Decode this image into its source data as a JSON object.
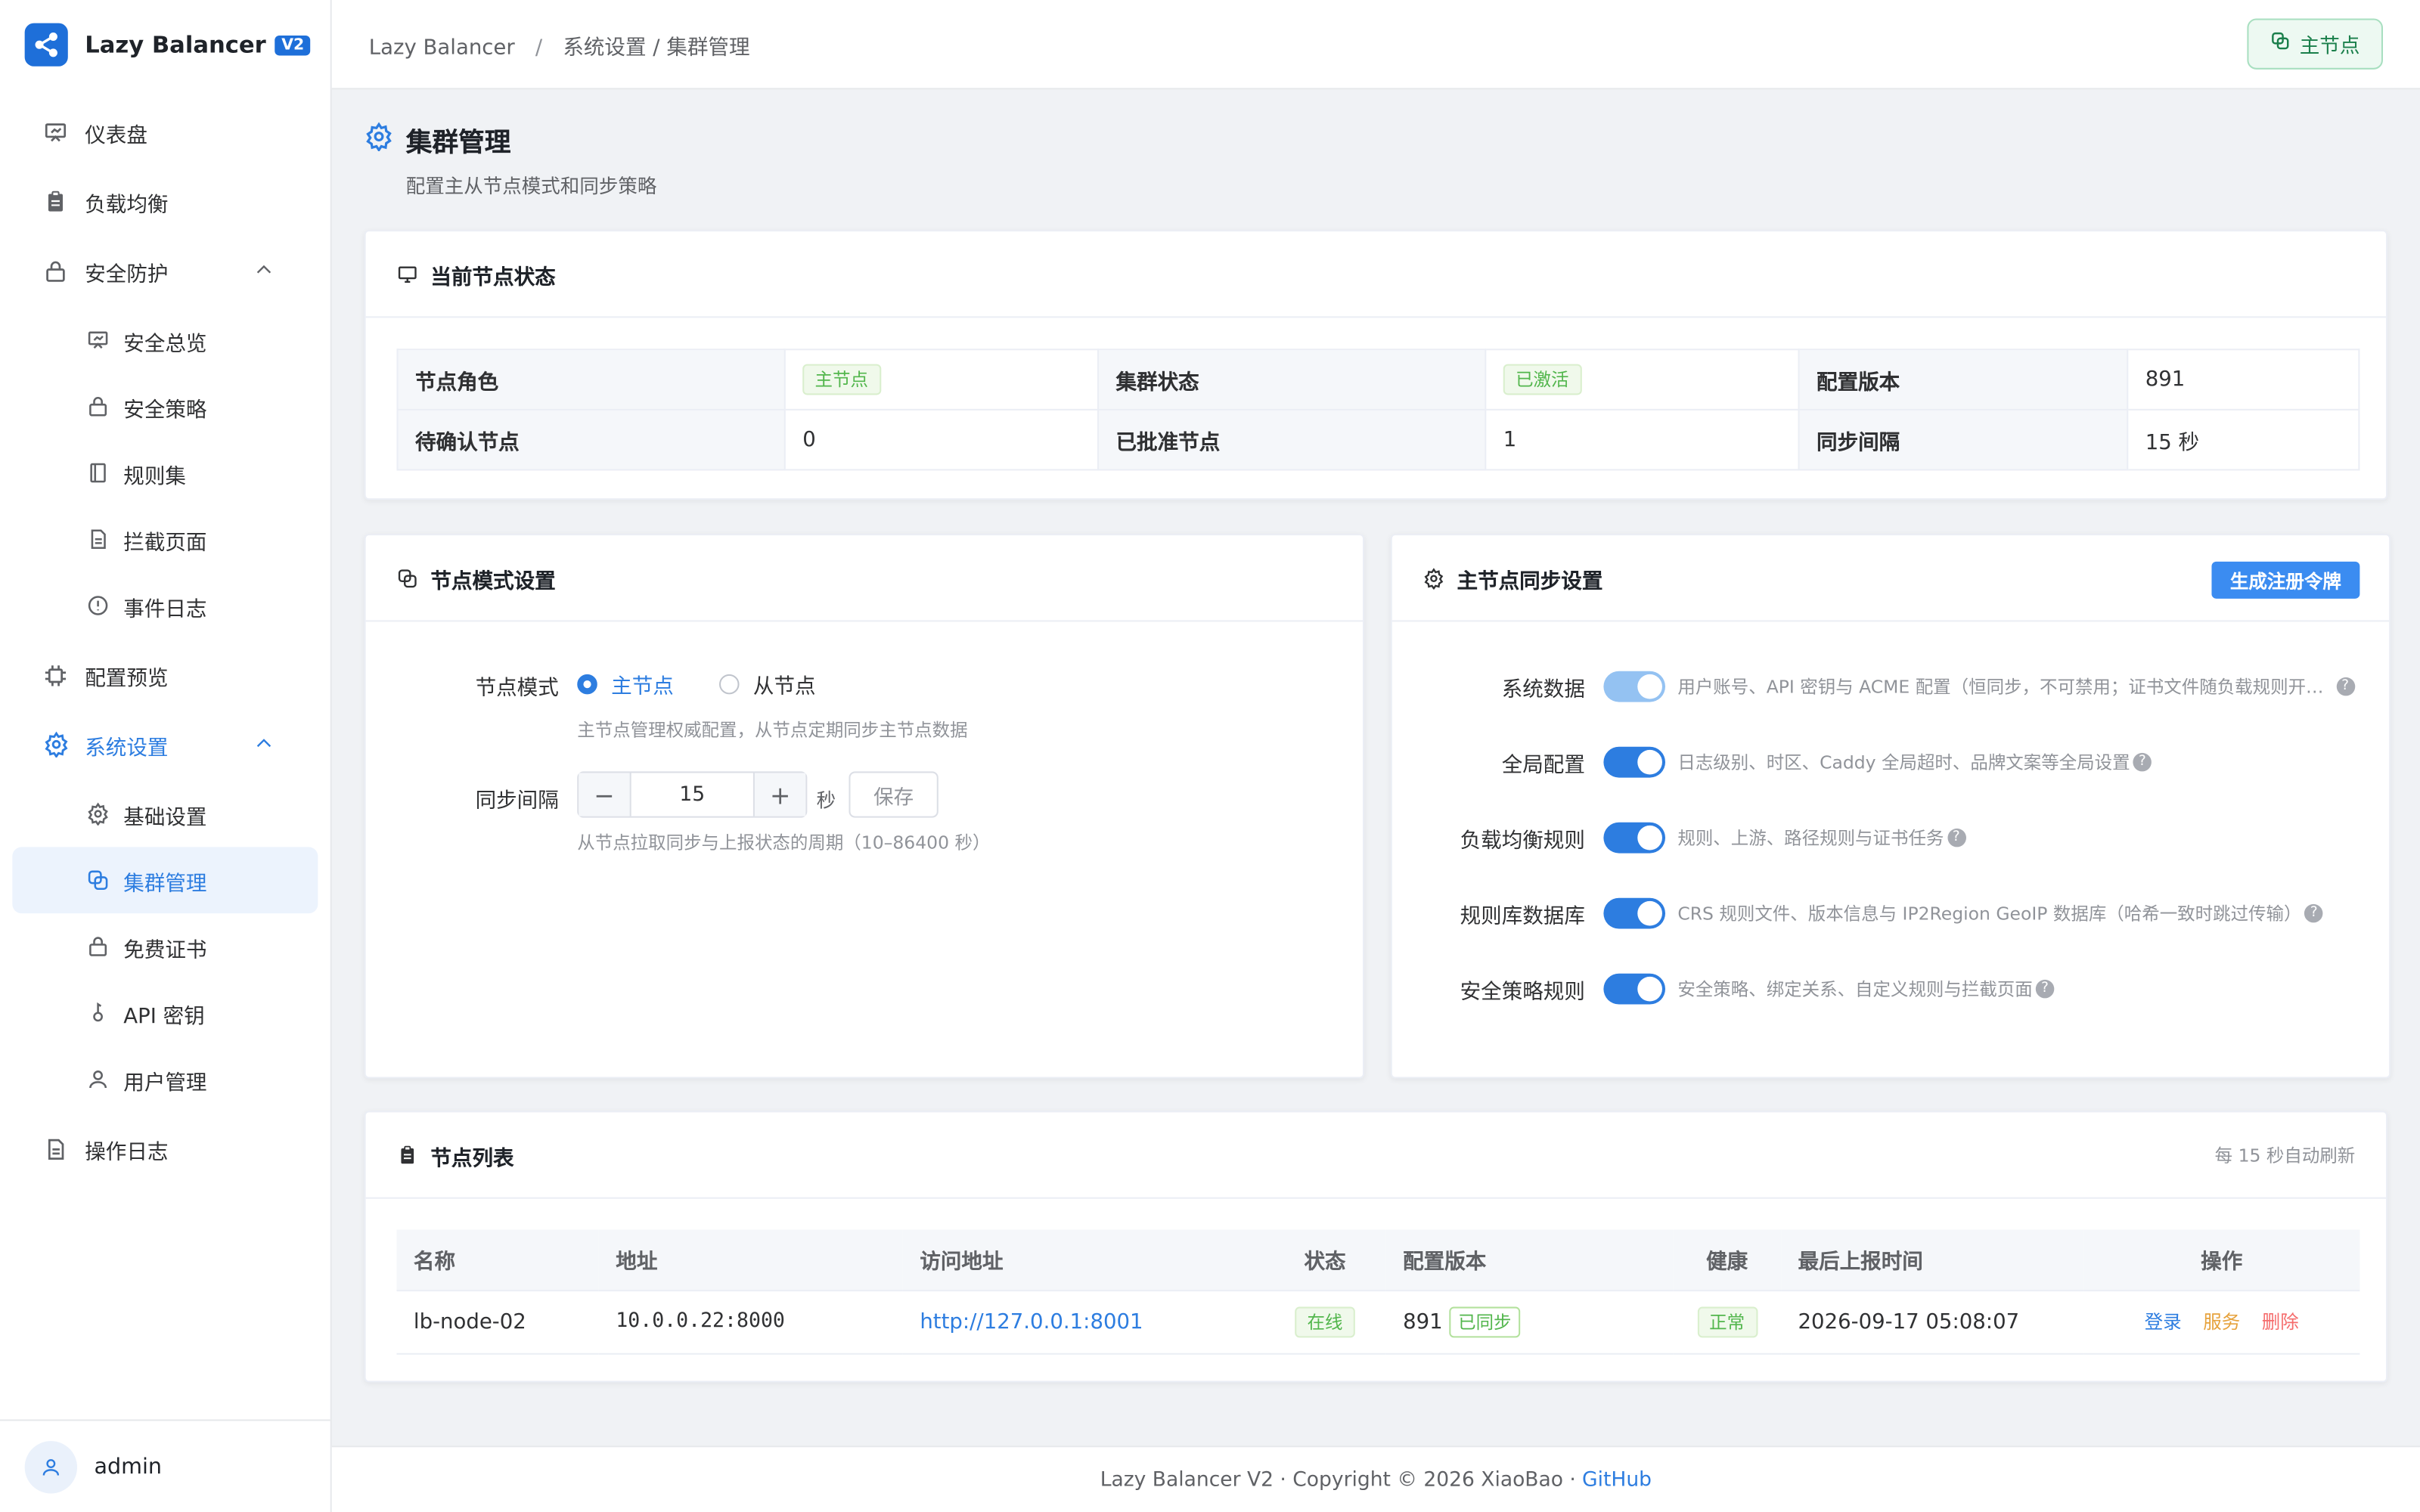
{
  "brand": {
    "name": "Lazy Balancer",
    "badge": "V2"
  },
  "sidebar": {
    "dashboard": "仪表盘",
    "load_balance": "负载均衡",
    "security": "安全防护",
    "security_overview": "安全总览",
    "security_policy": "安全策略",
    "rule_sets": "规则集",
    "block_page": "拦截页面",
    "event_log": "事件日志",
    "config_preview": "配置预览",
    "system_settings": "系统设置",
    "basic_settings": "基础设置",
    "cluster_mgmt": "集群管理",
    "free_cert": "免费证书",
    "api_key": "API 密钥",
    "user_mgmt": "用户管理",
    "operation_log": "操作日志"
  },
  "user": {
    "name": "admin"
  },
  "header": {
    "crumb_root": "Lazy Balancer",
    "crumb_sep": "/",
    "crumb_path": "系统设置 / 集群管理",
    "role_button": "主节点"
  },
  "page": {
    "title": "集群管理",
    "subtitle": "配置主从节点模式和同步策略"
  },
  "status_card": {
    "title": "当前节点状态",
    "node_role_label": "节点角色",
    "node_role_value": "主节点",
    "cluster_state_label": "集群状态",
    "cluster_state_value": "已激活",
    "config_version_label": "配置版本",
    "config_version_value": "891",
    "pending_label": "待确认节点",
    "pending_value": "0",
    "approved_label": "已批准节点",
    "approved_value": "1",
    "sync_interval_label": "同步间隔",
    "sync_interval_value": "15 秒"
  },
  "mode_card": {
    "title": "节点模式设置",
    "mode_label": "节点模式",
    "option_master": "主节点",
    "option_slave": "从节点",
    "mode_hint": "主节点管理权威配置，从节点定期同步主节点数据",
    "interval_label": "同步间隔",
    "interval_value": "15",
    "interval_unit": "秒",
    "save_label": "保存",
    "interval_hint": "从节点拉取同步与上报状态的周期（10–86400 秒）",
    "minus": "−",
    "plus": "+"
  },
  "sync_card": {
    "title": "主节点同步设置",
    "generate_button": "生成注册令牌",
    "rows": [
      {
        "label": "系统数据",
        "desc": "用户账号、API 密钥与 ACME 配置（恒同步，不可禁用；证书文件随负载规则开…",
        "enabled": true,
        "locked": true
      },
      {
        "label": "全局配置",
        "desc": "日志级别、时区、Caddy 全局超时、品牌文案等全局设置",
        "enabled": true,
        "locked": false
      },
      {
        "label": "负载均衡规则",
        "desc": "规则、上游、路径规则与证书任务",
        "enabled": true,
        "locked": false
      },
      {
        "label": "规则库数据库",
        "desc": "CRS 规则文件、版本信息与 IP2Region GeoIP 数据库（哈希一致时跳过传输）",
        "enabled": true,
        "locked": false
      },
      {
        "label": "安全策略规则",
        "desc": "安全策略、绑定关系、自定义规则与拦截页面",
        "enabled": true,
        "locked": false
      }
    ]
  },
  "node_list": {
    "title": "节点列表",
    "auto_refresh": "每 15 秒自动刷新",
    "columns": [
      "名称",
      "地址",
      "访问地址",
      "状态",
      "配置版本",
      "健康",
      "最后上报时间",
      "操作"
    ],
    "rows": [
      {
        "name": "lb-node-02",
        "address": "10.0.0.22:8000",
        "access_url": "http://127.0.0.1:8001",
        "status": "在线",
        "config_version": "891",
        "synced": "已同步",
        "health": "正常",
        "last_report": "2026-09-17 05:08:07",
        "op_login": "登录",
        "op_service": "服务",
        "op_delete": "删除"
      }
    ]
  },
  "footer": {
    "text": "Lazy Balancer V2 · Copyright © 2026 XiaoBao ·",
    "github": "GitHub"
  },
  "colors": {
    "primary": "#2d7de0",
    "success": "#52b64c",
    "warning": "#e6a23c",
    "danger": "#f56c6c"
  }
}
